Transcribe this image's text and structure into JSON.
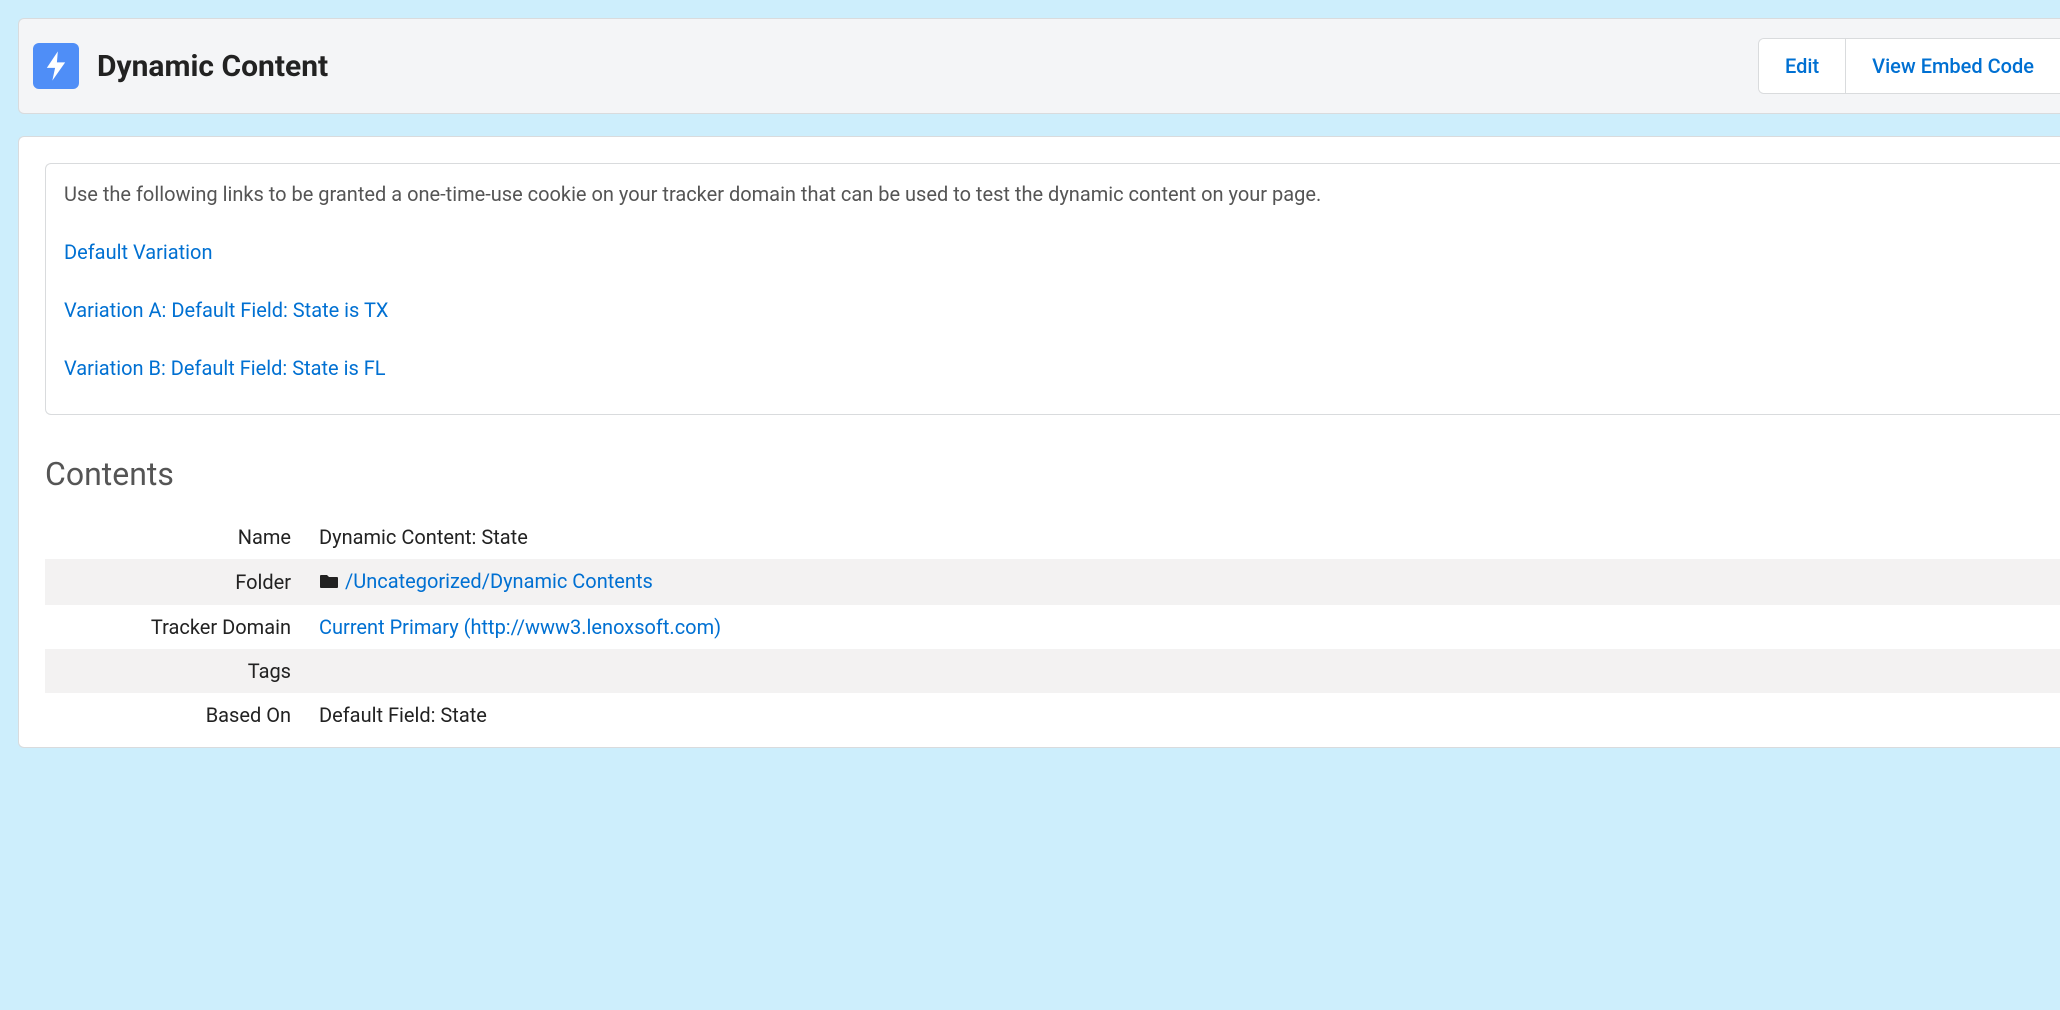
{
  "header": {
    "title": "Dynamic Content",
    "actions": {
      "edit": "Edit",
      "view_embed": "View Embed Code"
    }
  },
  "info": {
    "text": "Use the following links to be granted a one-time-use cookie on your tracker domain that can be used to test the dynamic content on your page.",
    "variations": [
      "Default Variation",
      "Variation A: Default Field: State is TX",
      "Variation B: Default Field: State is FL"
    ]
  },
  "section_heading": "Contents",
  "details": {
    "name_label": "Name",
    "name_value": "Dynamic Content: State",
    "folder_label": "Folder",
    "folder_value": "/Uncategorized/Dynamic Contents",
    "tracker_label": "Tracker Domain",
    "tracker_value": "Current Primary (http://www3.lenoxsoft.com)",
    "tags_label": "Tags",
    "tags_value": "",
    "based_on_label": "Based On",
    "based_on_value": "Default Field: State"
  }
}
